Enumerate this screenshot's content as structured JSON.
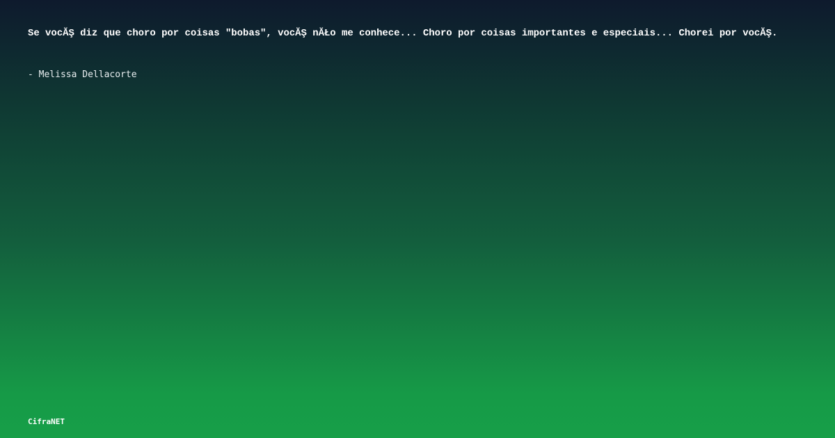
{
  "quote": {
    "text": "Se vocĂŞ diz que choro por coisas \"bobas\", vocĂŞ nĂŁo me conhece... Choro por coisas importantes e especiais... Chorei por vocĂŞ."
  },
  "author": {
    "text": "- Melissa Dellacorte"
  },
  "brand": {
    "name": "CifraNET"
  }
}
